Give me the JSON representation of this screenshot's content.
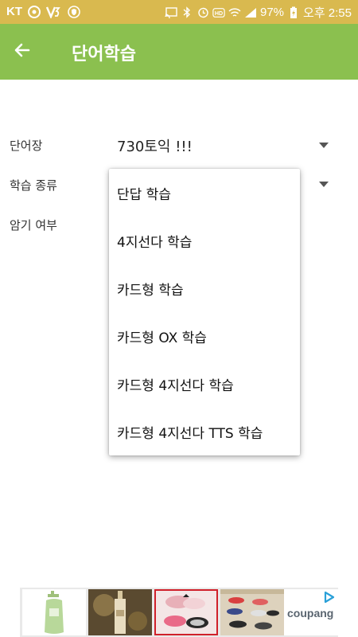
{
  "status_bar": {
    "carrier": "KT",
    "battery": "97%",
    "time": "오후 2:55",
    "icons": [
      "app-icon",
      "v3-icon",
      "shield-icon",
      "cast-icon",
      "bluetooth-icon",
      "alarm-icon",
      "hd-icon",
      "wifi-icon",
      "signal-icon",
      "battery-charging-icon"
    ]
  },
  "app_bar": {
    "title": "단어학습",
    "back_icon": "back-arrow-icon"
  },
  "form": {
    "wordbook": {
      "label": "단어장",
      "value": "730토익 !!!"
    },
    "study_type": {
      "label": "학습 종류"
    },
    "memorized": {
      "label": "암기 여부"
    }
  },
  "dropdown_menu": {
    "items": [
      "단답 학습",
      "4지선다 학습",
      "카드형 학습",
      "카드형 OX 학습",
      "카드형 4지선다 학습",
      "카드형 4지선다 TTS 학습"
    ]
  },
  "ad_banner": {
    "brand": "coupang",
    "tiles": [
      "lotion-product",
      "cosmetic-bottle-product",
      "shoes-product",
      "sneakers-product"
    ],
    "selected_tile": 2,
    "colors": {
      "brand_text": "#5a6570",
      "ad_choice": "#2aa0d8"
    }
  },
  "colors": {
    "status_bar": "#d9b94f",
    "app_bar": "#8bc04f"
  }
}
